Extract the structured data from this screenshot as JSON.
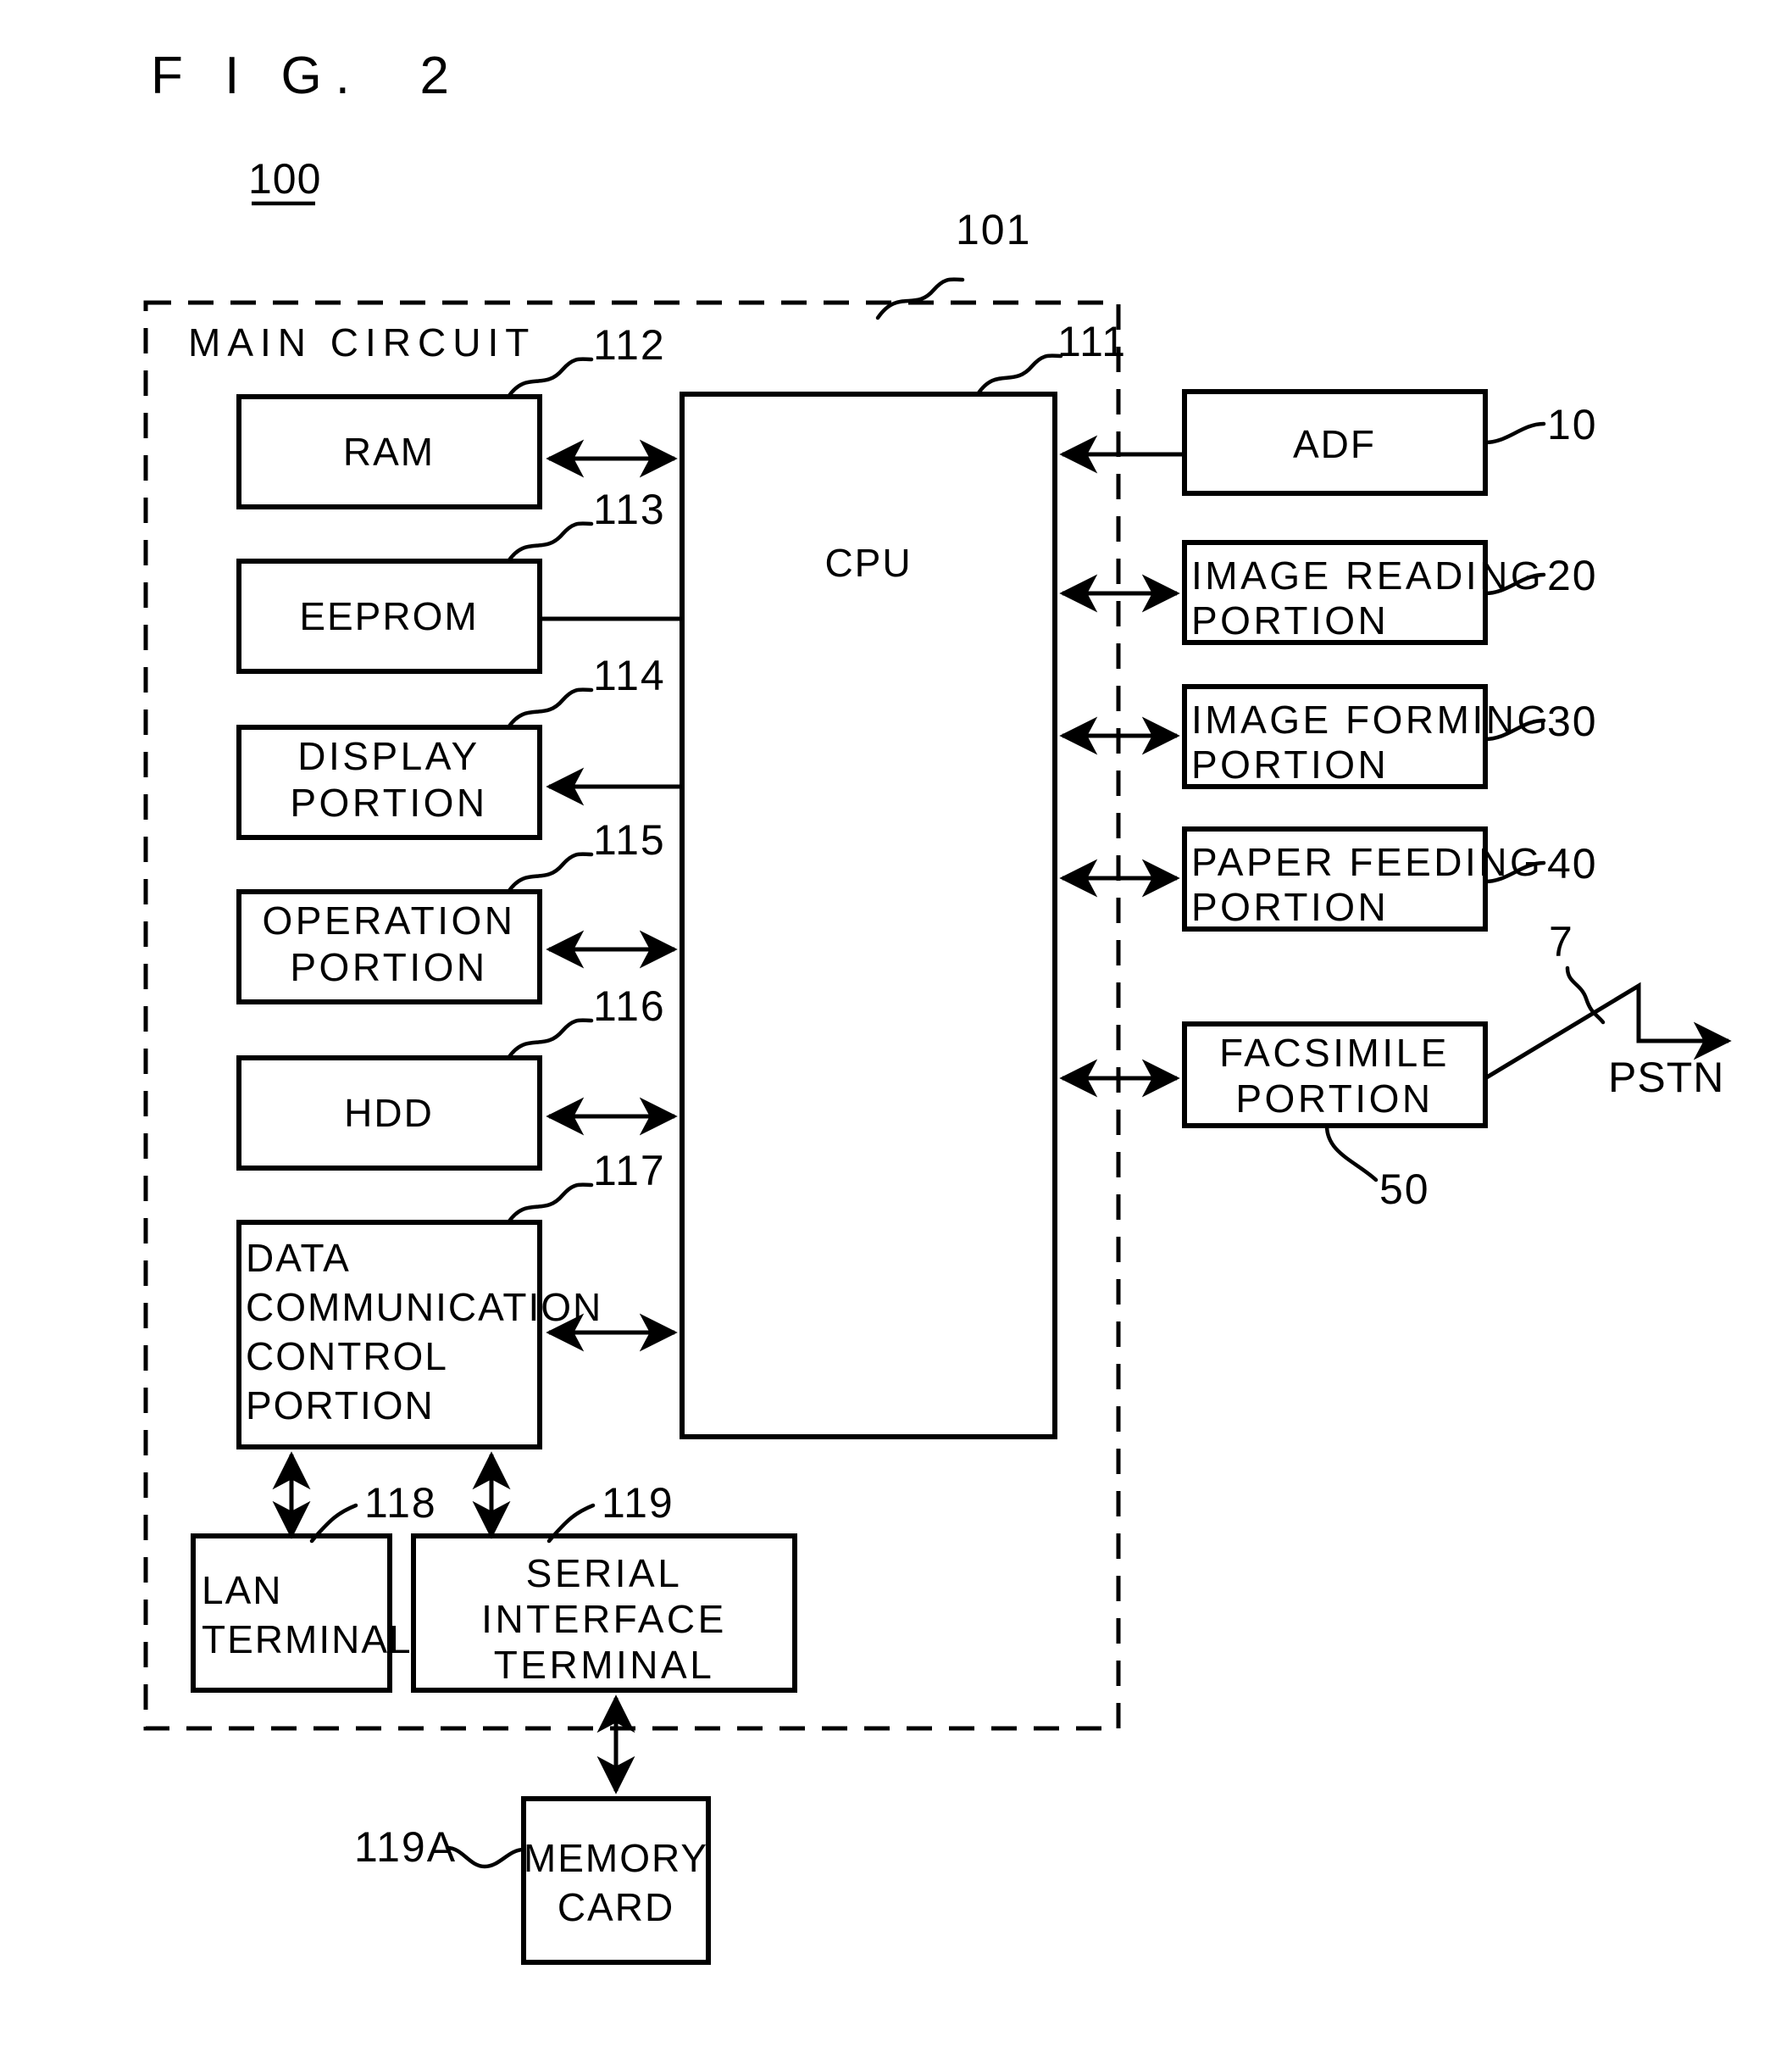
{
  "figure": {
    "title": "F I G.  2",
    "system_ref": "100",
    "enclosure_label": "MAIN CIRCUIT",
    "enclosure_ref": "101"
  },
  "cpu": {
    "label": "CPU",
    "ref": "111"
  },
  "left_blocks": [
    {
      "id": "ram",
      "ref": "112",
      "lines": [
        "RAM"
      ],
      "align": "center",
      "arrow": "both"
    },
    {
      "id": "eeprom",
      "ref": "113",
      "lines": [
        "EEPROM"
      ],
      "align": "center",
      "arrow": "none"
    },
    {
      "id": "display",
      "ref": "114",
      "lines": [
        "DISPLAY",
        "PORTION"
      ],
      "align": "center",
      "arrow": "left"
    },
    {
      "id": "operation",
      "ref": "115",
      "lines": [
        "OPERATION",
        "PORTION"
      ],
      "align": "center",
      "arrow": "both"
    },
    {
      "id": "hdd",
      "ref": "116",
      "lines": [
        "HDD"
      ],
      "align": "center",
      "arrow": "both"
    },
    {
      "id": "datacomm",
      "ref": "117",
      "lines": [
        "DATA",
        "COMMUNICATION",
        "CONTROL",
        "PORTION"
      ],
      "align": "left",
      "arrow": "both"
    }
  ],
  "right_blocks": [
    {
      "id": "adf",
      "ref": "10",
      "lines": [
        "ADF"
      ],
      "align": "center",
      "arrow": "left"
    },
    {
      "id": "image-reading",
      "ref": "20",
      "lines": [
        "IMAGE READING",
        "PORTION"
      ],
      "align": "left",
      "arrow": "both"
    },
    {
      "id": "image-forming",
      "ref": "30",
      "lines": [
        "IMAGE FORMING",
        "PORTION"
      ],
      "align": "left",
      "arrow": "both"
    },
    {
      "id": "paper-feeding",
      "ref": "40",
      "lines": [
        "PAPER FEEDING",
        "PORTION"
      ],
      "align": "left",
      "arrow": "both"
    },
    {
      "id": "facsimile",
      "ref": "50",
      "lines": [
        "FACSIMILE",
        "PORTION"
      ],
      "align": "center",
      "arrow": "both"
    }
  ],
  "terminals": [
    {
      "id": "lan",
      "ref": "118",
      "lines": [
        "LAN",
        "TERMINAL"
      ],
      "align": "left"
    },
    {
      "id": "serial",
      "ref": "119",
      "lines": [
        "SERIAL",
        "INTERFACE",
        "TERMINAL"
      ],
      "align": "center"
    }
  ],
  "external": {
    "memory_card": {
      "ref": "119A",
      "lines": [
        "MEMORY",
        "CARD"
      ]
    },
    "pstn": {
      "label": "PSTN",
      "ref": "7"
    }
  }
}
